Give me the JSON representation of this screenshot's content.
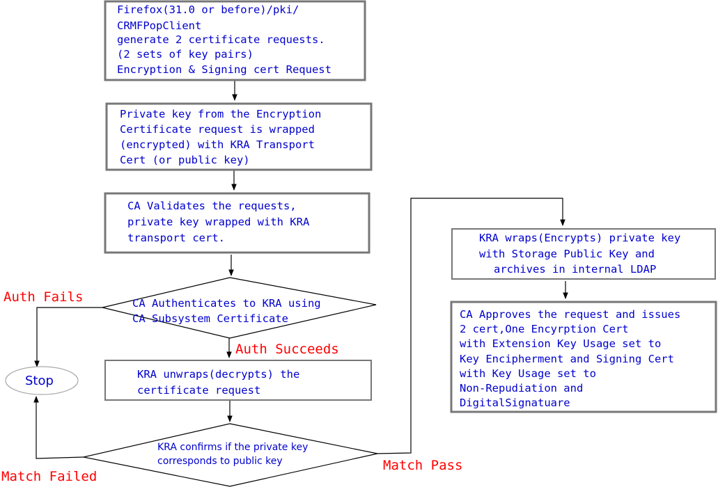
{
  "nodes": {
    "client_request": {
      "lines": [
        "Firefox(31.0 or before)/pki/",
        "CRMFPopClient",
        "generate 2 certificate requests.",
        "(2 sets of key pairs)",
        "Encryption & Signing cert Request"
      ]
    },
    "wrap_private_key": {
      "lines": [
        "Private key from the Encryption",
        "Certificate request is wrapped",
        "(encrypted) with KRA Transport",
        "Cert (or public key)"
      ]
    },
    "ca_validates": {
      "lines": [
        "CA Validates the requests,",
        "private key wrapped with KRA",
        "transport cert."
      ]
    },
    "ca_authenticates": {
      "lines": [
        "CA Authenticates to KRA using",
        "CA Subsystem Certificate"
      ]
    },
    "kra_unwraps": {
      "lines": [
        "KRA unwraps(decrypts) the",
        "certificate request"
      ]
    },
    "kra_confirms": {
      "lines": [
        "KRA confirms if the private key",
        "corresponds to public key"
      ]
    },
    "kra_archives": {
      "lines": [
        "KRA wraps(Encrypts) private key",
        "with Storage Public Key and",
        "archives in internal LDAP"
      ]
    },
    "ca_issues": {
      "lines": [
        "CA Approves the request and issues",
        "2 cert,One Encyrption Cert",
        "with Extension Key Usage set to",
        "Key Encipherment and Signing Cert",
        "with Key Usage set to",
        "Non-Repudiation and",
        "DigitalSignatuare"
      ]
    },
    "stop": {
      "label": "Stop"
    }
  },
  "edge_labels": {
    "auth_fails": "Auth Fails",
    "auth_succeeds": "Auth Succeeds",
    "match_failed": "Match Failed",
    "match_pass": "Match Pass"
  },
  "colors": {
    "node_text": "#0000cc",
    "edge_label": "#ff0000",
    "box_border": "#777777",
    "connector": "#000000"
  }
}
